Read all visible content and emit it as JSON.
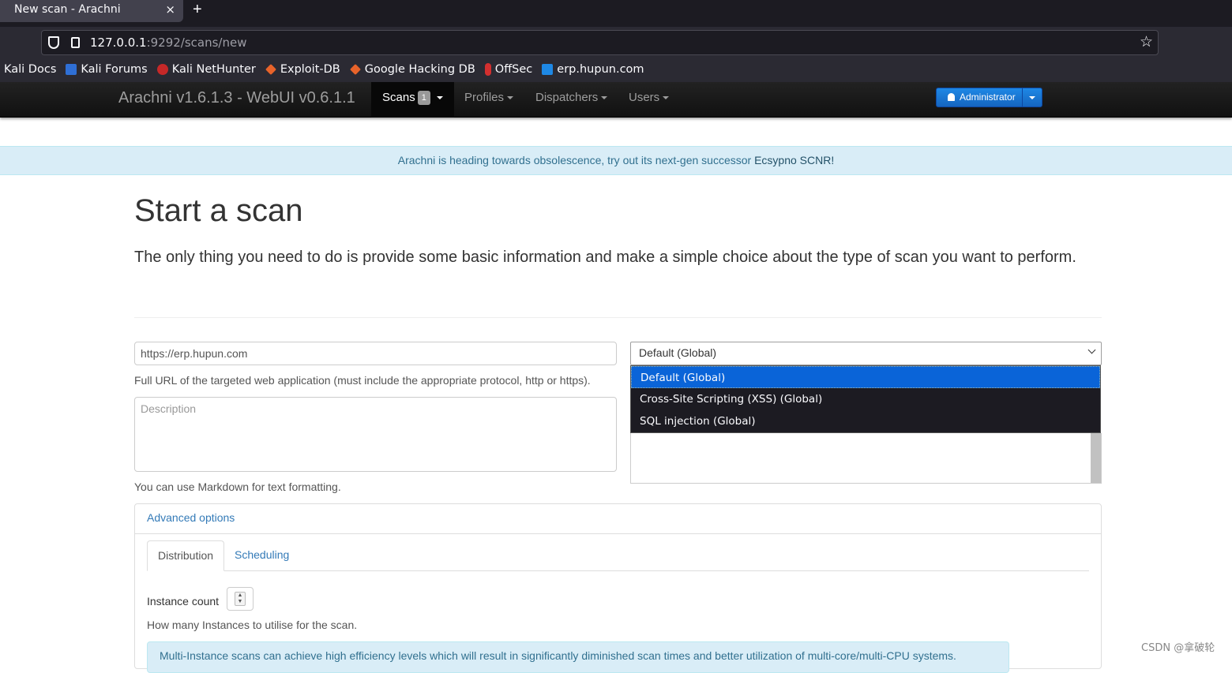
{
  "browser": {
    "tab_title": "New scan - Arachni",
    "tab_close": "×",
    "new_tab": "+",
    "url_host": "127.0.0.1",
    "url_rest": ":9292/scans/new",
    "bookmarks": [
      "Kali Docs",
      "Kali Forums",
      "Kali NetHunter",
      "Exploit-DB",
      "Google Hacking DB",
      "OffSec",
      "erp.hupun.com"
    ]
  },
  "app_nav": {
    "brand": "Arachni v1.6.1.3 - WebUI v0.6.1.1",
    "scans": "Scans",
    "scans_badge": "1",
    "profiles": "Profiles",
    "dispatchers": "Dispatchers",
    "users": "Users",
    "admin": "Administrator"
  },
  "notice": {
    "text": "Arachni is heading towards obsolescence, try out its next-gen successor ",
    "link": "Ecsypno SCNR!"
  },
  "main": {
    "title": "Start a scan",
    "lead": "The only thing you need to do is provide some basic information and make a simple choice about the type of scan you want to perform.",
    "url_value": "https://erp.hupun.com",
    "url_help": "Full URL of the targeted web application (must include the appropriate protocol, http or https).",
    "description_placeholder": "Description",
    "description_help": "You can use Markdown for text formatting.",
    "profile_selected": "Default (Global)",
    "profile_options": [
      "Default (Global)",
      "Cross-Site Scripting (XSS) (Global)",
      "SQL injection (Global)"
    ]
  },
  "advanced": {
    "heading": "Advanced options",
    "tab_distribution": "Distribution",
    "tab_scheduling": "Scheduling",
    "instance_label": "Instance count",
    "instance_help": "How many Instances to utilise for the scan.",
    "info": "Multi-Instance scans can achieve high efficiency levels which will result in significantly diminished scan times and better utilization of multi-core/multi-CPU systems."
  },
  "watermark": "CSDN @拿破轮"
}
